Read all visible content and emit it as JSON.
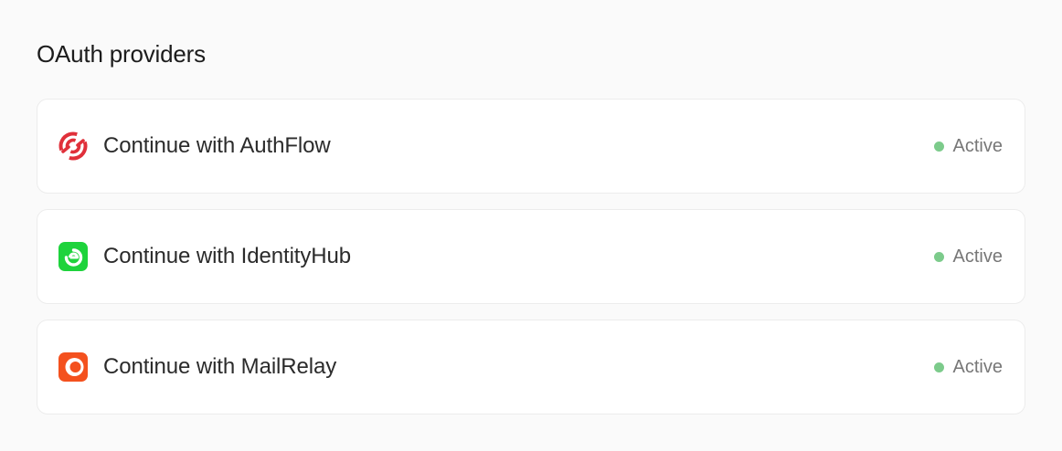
{
  "section": {
    "title": "OAuth providers"
  },
  "providers": [
    {
      "label": "Continue with AuthFlow",
      "icon": "authflow-logo-icon",
      "status": "Active",
      "brand_color": "#e0303a"
    },
    {
      "label": "Continue with IdentityHub",
      "icon": "identityhub-logo-icon",
      "status": "Active",
      "brand_color": "#1ed33c"
    },
    {
      "label": "Continue with MailRelay",
      "icon": "mailrelay-logo-icon",
      "status": "Active",
      "brand_color": "#f4511e"
    }
  ],
  "colors": {
    "status_active": "#7ccb8b",
    "background": "#fafafa",
    "card": "#ffffff"
  }
}
